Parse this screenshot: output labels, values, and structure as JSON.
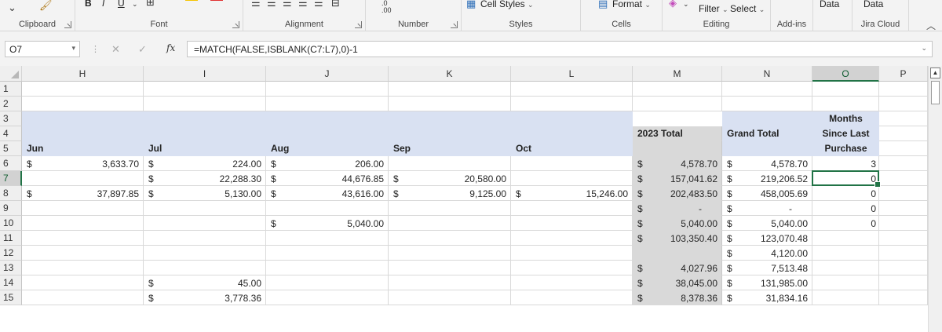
{
  "ribbon": {
    "groups": {
      "clipboard": "Clipboard",
      "font": "Font",
      "alignment": "Alignment",
      "number": "Number",
      "styles": "Styles",
      "cells": "Cells",
      "editing": "Editing",
      "addins": "Add-ins"
    },
    "cell_styles": "Cell Styles",
    "format": "Format",
    "filter": "Filter",
    "select": "Select",
    "data1": "Data",
    "data2": "Data",
    "jira_cloud": "Jira Cloud",
    "bold": "B",
    "italic": "I",
    "underline": "U",
    "increase_decimal_top": ".0",
    "increase_decimal_bottom": ".00"
  },
  "formula_bar": {
    "name_box": "O7",
    "fx": "fx",
    "formula": "=MATCH(FALSE,ISBLANK(C7:L7),0)-1"
  },
  "columns": [
    "H",
    "I",
    "J",
    "K",
    "L",
    "M",
    "N",
    "O",
    "P"
  ],
  "selected_column": "O",
  "selected_row": "7",
  "rows": [
    "1",
    "2",
    "3",
    "4",
    "5",
    "6",
    "7",
    "8",
    "9",
    "10",
    "11",
    "12",
    "13",
    "14",
    "15"
  ],
  "headers": {
    "jun": "Jun",
    "jul": "Jul",
    "aug": "Aug",
    "sep": "Sep",
    "oct": "Oct",
    "total_2023": "2023 Total",
    "grand_total": "Grand Total",
    "months_line1": "Months",
    "months_line2": "Since Last",
    "months_line3": "Purchase"
  },
  "data_rows": [
    {
      "row": "6",
      "H": "3,633.70",
      "I": "224.00",
      "J": "206.00",
      "K": "",
      "L": "",
      "M": "4,578.70",
      "N": "4,578.70",
      "O": "3"
    },
    {
      "row": "7",
      "H": "",
      "I": "22,288.30",
      "J": "44,676.85",
      "K": "20,580.00",
      "L": "",
      "M": "157,041.62",
      "N": "219,206.52",
      "O": "0"
    },
    {
      "row": "8",
      "H": "37,897.85",
      "I": "5,130.00",
      "J": "43,616.00",
      "K": "9,125.00",
      "L": "15,246.00",
      "M": "202,483.50",
      "N": "458,005.69",
      "O": "0"
    },
    {
      "row": "9",
      "H": "",
      "I": "",
      "J": "",
      "K": "",
      "L": "",
      "M": "-",
      "N": "-",
      "O": "0"
    },
    {
      "row": "10",
      "H": "",
      "I": "",
      "J": "5,040.00",
      "K": "",
      "L": "",
      "M": "5,040.00",
      "N": "5,040.00",
      "O": "0"
    },
    {
      "row": "11",
      "H": "",
      "I": "",
      "J": "",
      "K": "",
      "L": "",
      "M": "103,350.40",
      "N": "123,070.48",
      "O": ""
    },
    {
      "row": "12",
      "H": "",
      "I": "",
      "J": "",
      "K": "",
      "L": "",
      "M": "",
      "N": "4,120.00",
      "O": ""
    },
    {
      "row": "13",
      "H": "",
      "I": "",
      "J": "",
      "K": "",
      "L": "",
      "M": "4,027.96",
      "N": "7,513.48",
      "O": ""
    },
    {
      "row": "14",
      "H": "",
      "I": "45.00",
      "J": "",
      "K": "",
      "L": "",
      "M": "38,045.00",
      "N": "131,985.00",
      "O": ""
    },
    {
      "row": "15",
      "H": "",
      "I": "3,778.36",
      "J": "",
      "K": "",
      "L": "",
      "M": "8,378.36",
      "N": "31,834.16",
      "O": ""
    }
  ],
  "currency_symbol": "$",
  "colors": {
    "header_band": "#d9e1f2",
    "total_band": "#d9d9d9",
    "accent": "#217346"
  }
}
